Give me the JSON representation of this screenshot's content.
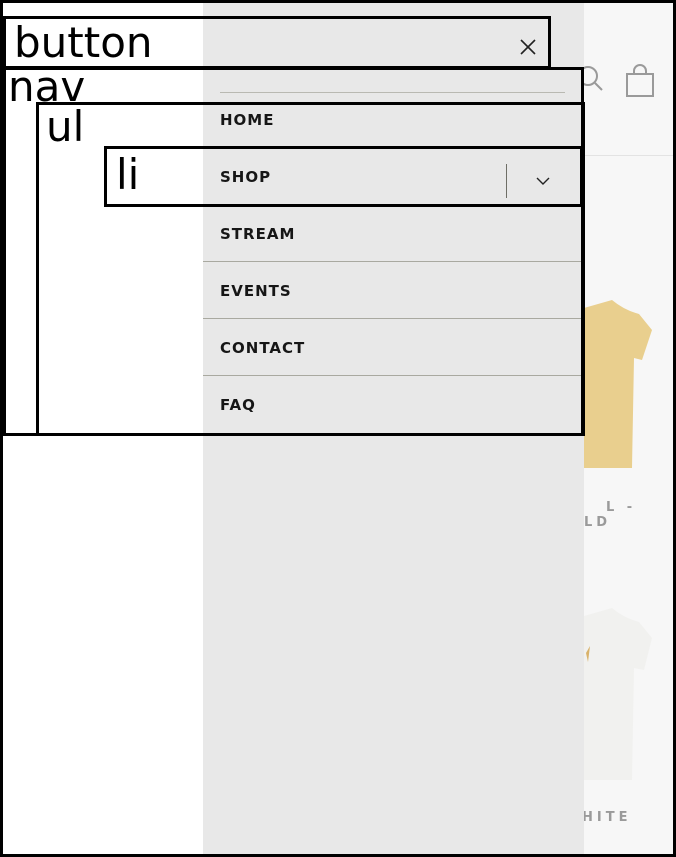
{
  "header": {
    "icons": [
      "search-icon",
      "bag-icon"
    ]
  },
  "drawer": {
    "close_icon": "close-icon",
    "menu": [
      {
        "label": "HOME"
      },
      {
        "label": "SHOP",
        "has_submenu": true
      },
      {
        "label": "STREAM"
      },
      {
        "label": "EVENTS"
      },
      {
        "label": "CONTACT"
      },
      {
        "label": "FAQ"
      }
    ]
  },
  "products": {
    "caption_1a": "L -",
    "caption_1b": "LD",
    "caption_2": "HITE"
  },
  "overlay_labels": {
    "button": "button",
    "nav": "nav",
    "ul": "ul",
    "li": "li"
  },
  "colors": {
    "drawer_bg": "#e8e8e8",
    "text": "#161616",
    "tee_yellow": "#e9cf8e",
    "tee_white": "#f3f3f1"
  }
}
